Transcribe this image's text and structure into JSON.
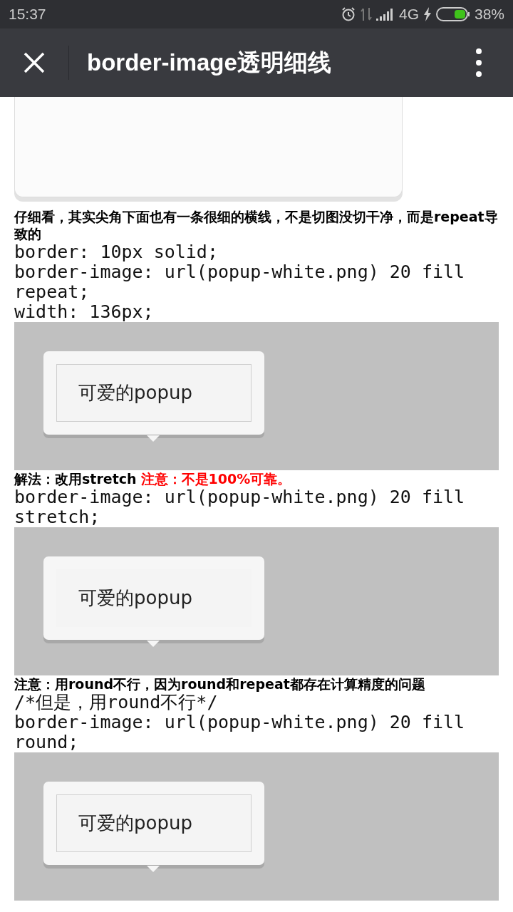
{
  "status_bar": {
    "time": "15:37",
    "network": "4G",
    "battery": "38%"
  },
  "toolbar": {
    "title": "border-image透明细线"
  },
  "top_popup": {
    "kind": "popup"
  },
  "sections": [
    {
      "note": "仔细看，其实尖角下面也有一条很细的横线，不是切图没切干净，而是repeat导致的",
      "code": [
        "border: 10px solid;",
        "border-image: url(popup-white.png) 20 fill repeat;",
        "width: 136px;"
      ],
      "demo": {
        "label": "可爱的popup",
        "inner_border": true
      }
    },
    {
      "note": "解法：改用stretch",
      "warning": "注意：不是100%可靠。",
      "code": [
        "border-image: url(popup-white.png) 20 fill stretch;"
      ],
      "demo": {
        "label": "可爱的popup",
        "inner_border": false
      }
    },
    {
      "note": "注意：用round不行，因为round和repeat都存在计算精度的问题",
      "code": [
        "/*但是，用round不行*/",
        "border-image: url(popup-white.png) 20 fill round;"
      ],
      "demo": {
        "label": "可爱的popup",
        "inner_border": true
      }
    }
  ]
}
